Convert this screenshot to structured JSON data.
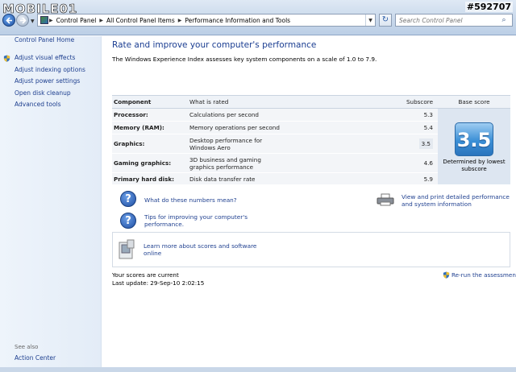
{
  "watermark": {
    "brand": "MOBILE01",
    "id": "#592707"
  },
  "address_bar": {
    "breadcrumbs": [
      "Control Panel",
      "All Control Panel Items",
      "Performance Information and Tools"
    ],
    "search_placeholder": "Search Control Panel"
  },
  "sidebar": {
    "home": "Control Panel Home",
    "items": [
      {
        "label": "Adjust visual effects",
        "icon": "uac-shield-icon"
      },
      {
        "label": "Adjust indexing options"
      },
      {
        "label": "Adjust power settings"
      },
      {
        "label": "Open disk cleanup"
      },
      {
        "label": "Advanced tools"
      }
    ],
    "see_also": "See also",
    "action_center": "Action Center"
  },
  "main": {
    "title": "Rate and improve your computer's performance",
    "intro": "The Windows Experience Index assesses key system components on a scale of 1.0 to 7.9.",
    "table": {
      "headers": {
        "component": "Component",
        "what": "What is rated",
        "subscore": "Subscore",
        "base": "Base score"
      },
      "rows": [
        {
          "component": "Processor:",
          "what": "Calculations per second",
          "subscore": "5.3"
        },
        {
          "component": "Memory (RAM):",
          "what": "Memory operations per second",
          "subscore": "5.4"
        },
        {
          "component": "Graphics:",
          "what": "Desktop performance for Windows Aero",
          "subscore": "3.5"
        },
        {
          "component": "Gaming graphics:",
          "what": "3D business and gaming graphics performance",
          "subscore": "4.6"
        },
        {
          "component": "Primary hard disk:",
          "what": "Disk data transfer rate",
          "subscore": "5.9"
        }
      ],
      "base_score": "3.5",
      "base_caption": "Determined by lowest subscore"
    },
    "links": {
      "what_mean": "What do these numbers mean?",
      "tips": "Tips for improving your computer's performance.",
      "print": "View and print detailed performance and system information",
      "learn": "Learn more about scores and software online"
    },
    "status": {
      "current": "Your scores are current",
      "last_update": "Last update: 29-Sep-10 2:02:15",
      "rerun": "Re-run the assessment"
    }
  },
  "colors": {
    "link": "#1e3f8f",
    "title": "#1a3d91",
    "badge": "#3b8fd6"
  }
}
